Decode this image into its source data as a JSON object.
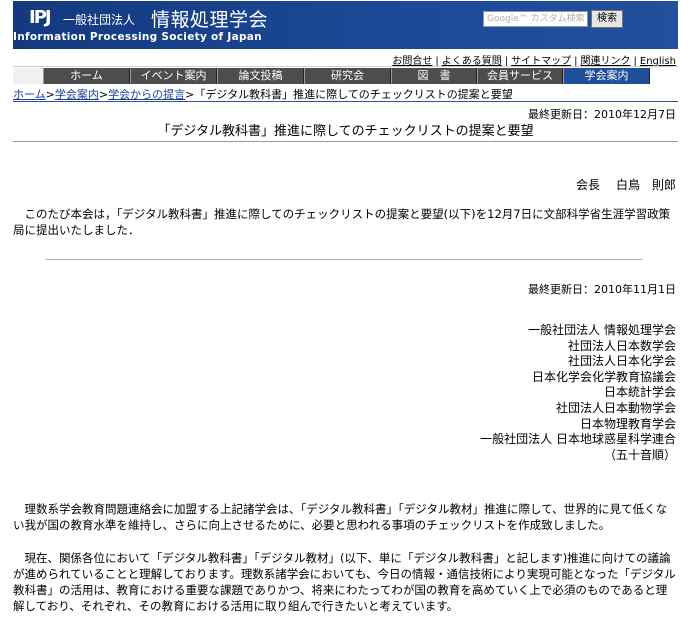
{
  "header": {
    "logo_mark": "IPJ",
    "org_type": "一般社団法人",
    "org_name": "情報処理学会",
    "org_name_en": "Information Processing Society of Japan",
    "search_placeholder": "Google™ カスタム検索",
    "search_button": "検索"
  },
  "util_links": [
    "お問合せ",
    "よくある質問",
    "サイトマップ",
    "関連リンク",
    "English"
  ],
  "nav": {
    "items": [
      "ホーム",
      "イベント案内",
      "論文投稿",
      "研究会",
      "図　書",
      "会員サービス",
      "学会案内"
    ],
    "active": "学会案内"
  },
  "breadcrumb": {
    "items": [
      "ホーム",
      "学会案内",
      "学会からの提言"
    ],
    "current": "「デジタル教科書」推進に際してのチェックリストの提案と要望",
    "separator": ">"
  },
  "page": {
    "updated_1": "最終更新日：2010年12月7日",
    "title": "「デジタル教科書」推進に際してのチェックリストの提案と要望",
    "president_title": "会長",
    "president_name": "白鳥　則郎",
    "intro": "　このたび本会は，「デジタル教科書」推進に際してのチェックリストの提案と要望(以下)を12月7日に文部科学省生涯学習政策局に提出いたしました．",
    "updated_2": "最終更新日：2010年11月1日",
    "societies": [
      "一般社団法人 情報処理学会",
      "社団法人日本数学会",
      "社団法人日本化学会",
      "日本化学会化学教育協議会",
      "日本統計学会",
      "社団法人日本動物学会",
      "日本物理教育学会",
      "一般社団法人 日本地球惑星科学連合",
      "（五十音順）"
    ],
    "body_1": "　理数系学会教育問題連絡会に加盟する上記諸学会は、「デジタル教科書」「デジタル教材」推進に際して、世界的に見て低くない我が国の教育水準を維持し、さらに向上させるために、必要と思われる事項のチェックリストを作成致しました。",
    "body_2": "　現在、関係各位において「デジタル教科書」「デジタル教材」(以下、単に「デジタル教科書」と記します)推進に向けての議論が進められていることと理解しております。理数系諸学会においても、今日の情報・通信技術により実現可能となった「デジタル教科書」の活用は、教育における重要な課題でありかつ、将来にわたってわが国の教育を高めていく上で必須のものであると理解しており、それぞれ、その教育における活用に取り組んで行きたいと考えています。"
  }
}
